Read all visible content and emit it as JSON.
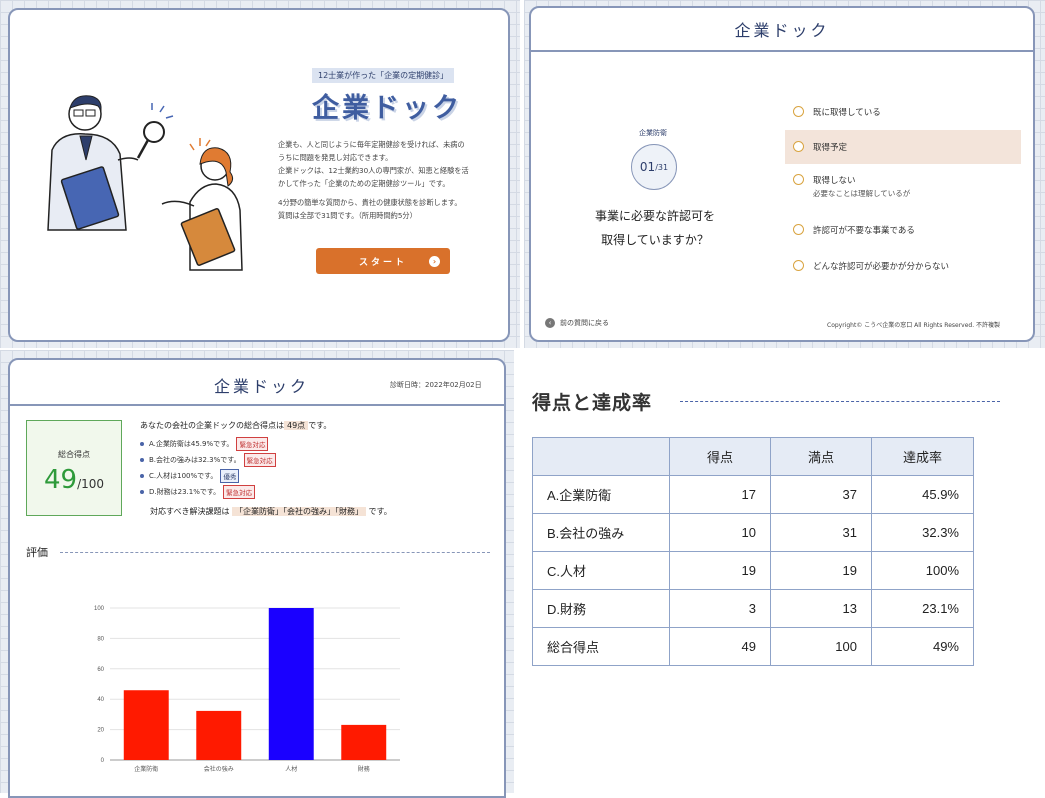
{
  "brand_color": "#2d3e6b",
  "accent_color": "#d9712b",
  "landing": {
    "tagline": "12士業が作った「企業の定期健診」",
    "title": "企業ドック",
    "description_lines": [
      "企業も、人と同じように毎年定期健診を受ければ、未病の",
      "うちに問題を発見し対応できます。",
      "企業ドックは、12士業約30人の専門家が、知恵と経験を活",
      "かして作った「企業のための定期健診ツール」です。"
    ],
    "info_lines": [
      "4分野の簡単な質問から、貴社の健康状態を診断します。",
      "質問は全部で31問です。（所用時間約5分）"
    ],
    "start_label": "スタート"
  },
  "question": {
    "header_title": "企業ドック",
    "category": "企業防衛",
    "counter_current": "01",
    "counter_total": "/31",
    "text_line1": "事業に必要な許認可を",
    "text_line2": "取得していますか？",
    "options": [
      {
        "label": "既に取得している",
        "sub": ""
      },
      {
        "label": "取得予定",
        "sub": "",
        "selected": true
      },
      {
        "label": "取得しない",
        "sub": "必要なことは理解しているが"
      },
      {
        "label": "許認可が不要な事業である",
        "sub": ""
      },
      {
        "label": "どんな許認可が必要かが分からない",
        "sub": ""
      }
    ],
    "back_label": "前の質問に戻る",
    "copyright": "Copyright© こうべ企業の窓口 All Rights Reserved. 不許複製"
  },
  "result": {
    "header_title": "企業ドック",
    "diagnosis_date": "診断日時：2022年02月02日",
    "score_label": "総合得点",
    "score_value": "49",
    "score_max": "/100",
    "summary_prefix": "あなたの会社の企業ドックの総合得点は",
    "summary_value": "49点",
    "summary_suffix": "です。",
    "items": [
      {
        "text": "A.企業防衛は45.9%です。",
        "badge": "緊急対応",
        "badge_type": "red"
      },
      {
        "text": "B.会社の強みは32.3%です。",
        "badge": "緊急対応",
        "badge_type": "red"
      },
      {
        "text": "C.人材は100%です。",
        "badge": "優秀",
        "badge_type": "blue"
      },
      {
        "text": "D.財務は23.1%です。",
        "badge": "緊急対応",
        "badge_type": "red"
      }
    ],
    "issues_prefix": "対応すべき解決課題は",
    "issues_value": "「企業防衛」「会社の強み」「財務」",
    "issues_suffix": "です。",
    "eval_title": "評価"
  },
  "chart_data": {
    "type": "bar",
    "categories": [
      "企業防衛",
      "会社の強み",
      "人材",
      "財務"
    ],
    "values": [
      45.9,
      32.3,
      100,
      23.1
    ],
    "colors": [
      "#ff1a00",
      "#ff1a00",
      "#1a00ff",
      "#ff1a00"
    ],
    "ylim": [
      0,
      100
    ],
    "yticks": [
      "0",
      "20",
      "40",
      "60",
      "80",
      "100"
    ],
    "grid": true,
    "title": "",
    "xlabel": "",
    "ylabel": ""
  },
  "score_table": {
    "title": "得点と達成率",
    "headers": [
      "",
      "得点",
      "満点",
      "達成率"
    ],
    "rows": [
      [
        "A.企業防衛",
        "17",
        "37",
        "45.9%"
      ],
      [
        "B.会社の強み",
        "10",
        "31",
        "32.3%"
      ],
      [
        "C.人材",
        "19",
        "19",
        "100%"
      ],
      [
        "D.財務",
        "3",
        "13",
        "23.1%"
      ],
      [
        "総合得点",
        "49",
        "100",
        "49%"
      ]
    ]
  }
}
